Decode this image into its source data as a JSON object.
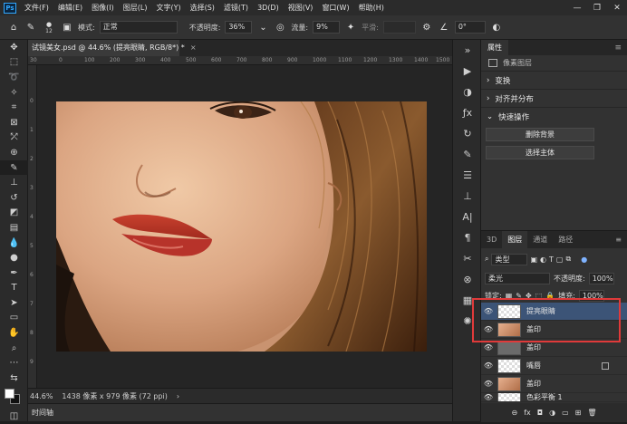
{
  "menubar": {
    "logo": "Ps",
    "items": [
      "文件(F)",
      "编辑(E)",
      "图像(I)",
      "图层(L)",
      "文字(Y)",
      "选择(S)",
      "滤镜(T)",
      "3D(D)",
      "视图(V)",
      "窗口(W)",
      "帮助(H)"
    ],
    "minimize": "—",
    "maximize": "❐",
    "close": "✕"
  },
  "options": {
    "brush_size": "12",
    "mode_label": "模式:",
    "mode_value": "正常",
    "opacity_label": "不透明度:",
    "opacity_value": "36%",
    "flow_label": "流量:",
    "flow_value": "9%",
    "smoothing_label": "平滑:",
    "angle_value": "0°"
  },
  "document": {
    "tab_title": "试镜美女.psd @ 44.6% (提亮眼睛, RGB/8*) *",
    "zoom": "44.6%",
    "size_info": "1438 像素 x 979 像素 (72 ppi)",
    "timeline": "时间轴",
    "ruler_top": [
      "30",
      "0",
      "100",
      "200",
      "300",
      "400",
      "500",
      "600",
      "700",
      "800",
      "900",
      "1000",
      "1100",
      "1200",
      "1300",
      "1400",
      "1500"
    ],
    "ruler_left": [
      "0",
      "1",
      "2",
      "3",
      "4",
      "5",
      "6",
      "7",
      "8",
      "9"
    ]
  },
  "properties": {
    "tab": "属性",
    "pixel_layer": "像素图层",
    "sections": [
      "变换",
      "对齐并分布",
      "快速操作"
    ],
    "buttons": [
      "删除背景",
      "选择主体"
    ]
  },
  "layers_panel": {
    "tabs": [
      "3D",
      "图层",
      "通道",
      "路径"
    ],
    "filter": "类型",
    "blend_mode": "柔光",
    "opacity_label": "不透明度:",
    "opacity_value": "100%",
    "lock_label": "锁定:",
    "fill_label": "填充:",
    "fill_value": "100%",
    "layers": [
      {
        "name": "提亮眼睛",
        "thumb": "checker",
        "selected": true
      },
      {
        "name": "盖印",
        "thumb": "face",
        "selected": false
      },
      {
        "name": "盖印",
        "thumb": "gray",
        "selected": false
      },
      {
        "name": "嘴唇",
        "thumb": "lips",
        "selected": false
      },
      {
        "name": "盖印",
        "thumb": "face",
        "selected": false
      },
      {
        "name": "色彩平衡 1",
        "thumb": "checker",
        "selected": false
      }
    ]
  },
  "colors": {
    "highlight": "#e03a3a",
    "selected_layer": "#3c5477"
  }
}
